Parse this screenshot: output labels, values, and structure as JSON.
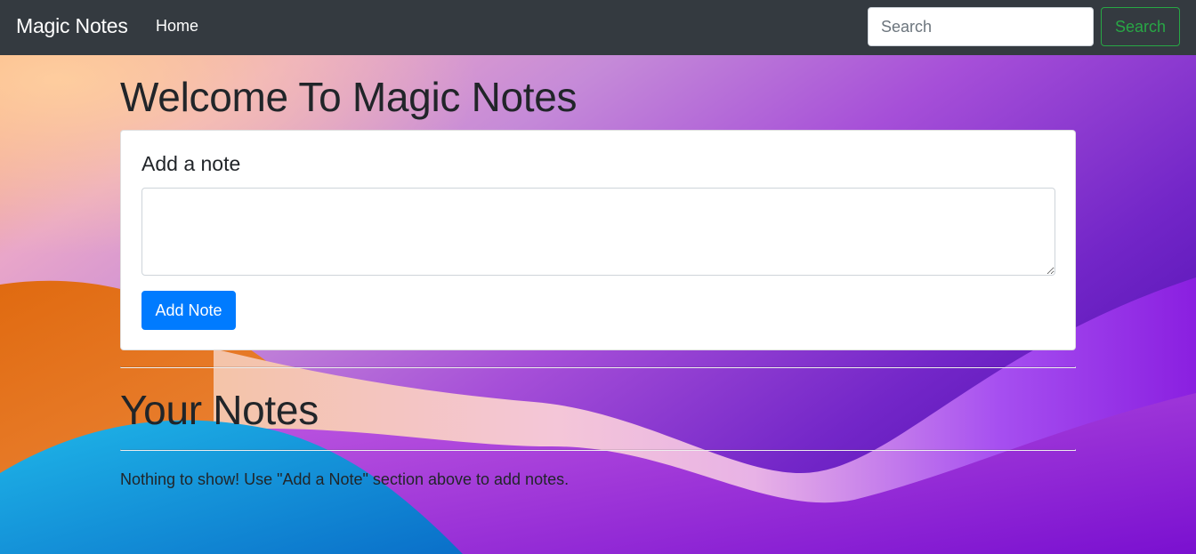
{
  "navbar": {
    "brand": "Magic Notes",
    "links": [
      {
        "label": "Home"
      }
    ],
    "search": {
      "placeholder": "Search",
      "value": "",
      "button_label": "Search"
    }
  },
  "main": {
    "title": "Welcome To Magic Notes",
    "add_card": {
      "title": "Add a note",
      "textarea_value": "",
      "button_label": "Add Note"
    },
    "notes_section": {
      "title": "Your Notes",
      "empty_message": "Nothing to show! Use \"Add a Note\" section above to add notes."
    }
  },
  "colors": {
    "navbar_bg": "#343a40",
    "primary": "#007bff",
    "success": "#28a745",
    "text": "#212529"
  }
}
